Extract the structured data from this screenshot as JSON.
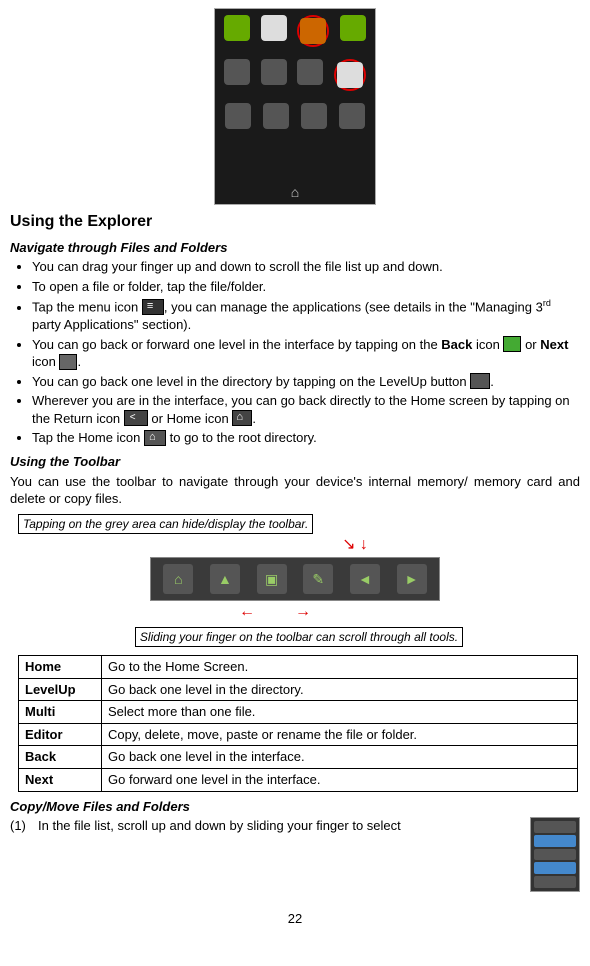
{
  "section_title": "Using the Explorer",
  "nav_heading": "Navigate through Files and Folders",
  "bullets": {
    "b1": "You can drag your finger up and down to scroll the file list up and down.",
    "b2": "To open a file or folder, tap the file/folder.",
    "b3a": "Tap the menu icon ",
    "b3b": ", you can manage the applications (see details in the \"Managing 3",
    "b3sup": "rd",
    "b3c": " party Applications\" section).",
    "b4a": "You can go back or forward one level in the interface by tapping on the ",
    "b4back": "Back",
    "b4b": " icon ",
    "b4c": " or ",
    "b4next": "Next",
    "b4d": " icon ",
    "b4e": ".",
    "b5a": "You can go back one level in the directory by tapping on the LevelUp button ",
    "b5b": ".",
    "b6a": "Wherever you are in the interface, you can go back directly to the Home screen by tapping on the Return icon ",
    "b6b": " or Home icon ",
    "b6c": ".",
    "b7a": "Tap the Home icon ",
    "b7b": " to go to the root directory."
  },
  "toolbar_heading": "Using the Toolbar",
  "toolbar_para": "You can use the toolbar to navigate through your device's internal memory/ memory card and delete or copy files.",
  "callout_top": "Tapping on the grey area can hide/display the toolbar.",
  "callout_bottom": "Sliding your finger on the toolbar can scroll through all tools.",
  "table": [
    {
      "name": "Home",
      "desc": "Go to the Home Screen."
    },
    {
      "name": "LevelUp",
      "desc": "Go back one level in the directory."
    },
    {
      "name": "Multi",
      "desc": "Select more than one file."
    },
    {
      "name": "Editor",
      "desc": "Copy, delete, move, paste or rename the file or folder."
    },
    {
      "name": "Back",
      "desc": "Go back one level in the interface."
    },
    {
      "name": "Next",
      "desc": "Go forward one level in the interface."
    }
  ],
  "copy_heading": "Copy/Move Files and Folders",
  "copy_step_num": "(1)",
  "copy_step_text": "In the file list, scroll up and down by sliding your finger to select",
  "page_number": "22"
}
